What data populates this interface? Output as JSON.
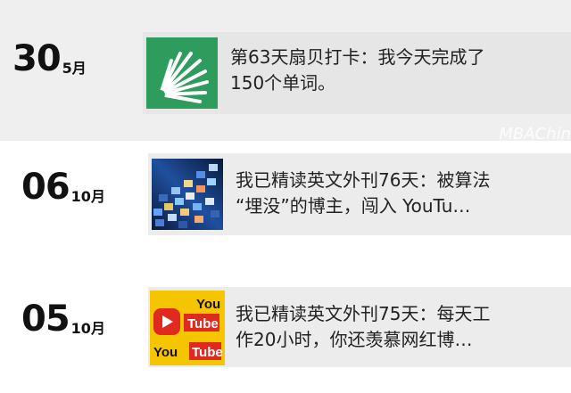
{
  "posts": [
    {
      "day": "30",
      "month": "5月",
      "thumbnail_icon": "shanbay-fan-logo-icon",
      "title_line1": "第63天扇贝打卡：我今天完成了",
      "title_line2": "150个单词。"
    },
    {
      "day": "06",
      "month": "10月",
      "thumbnail_icon": "video-wall-image",
      "title_line1": "我已精读英文外刊76天：被算法",
      "title_line2": "“埋没”的博主，闯入 YouTu…"
    },
    {
      "day": "05",
      "month": "10月",
      "thumbnail_icon": "youtube-logo-icon",
      "thumb_text_top": "You",
      "thumb_text_mid": "Tube",
      "thumb_text_bottom_left": "You",
      "thumb_text_bottom_right": "Tube",
      "title_line1": "我已精读英文外刊75天：每天工",
      "title_line2": "作20小时，你还羡慕网红博…"
    }
  ],
  "watermark": "MBAChin",
  "colors": {
    "shanbay_green": "#2e9c5d",
    "youtube_red": "#e02a1f",
    "youtube_yellow": "#f5c600"
  }
}
